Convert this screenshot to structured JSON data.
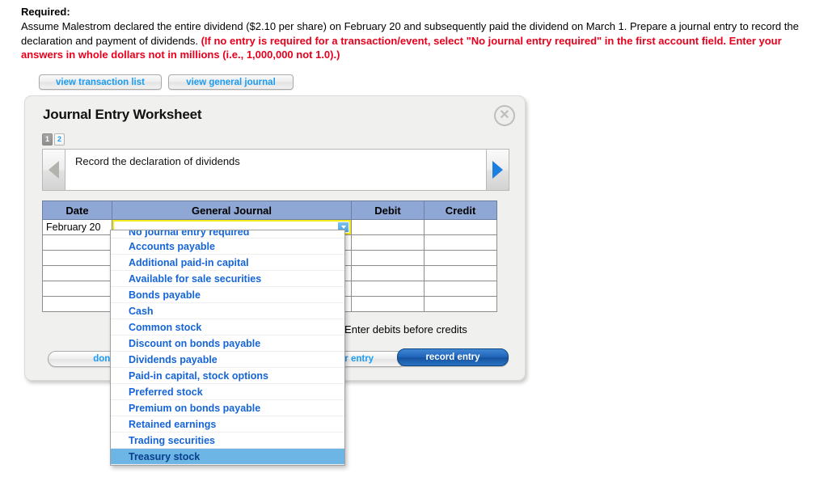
{
  "prompt": {
    "label": "Required:",
    "body_plain": "Assume Malestrom declared the entire dividend ($2.10 per share) on February 20 and subsequently paid the dividend on March 1. Prepare a journal entry to record the declaration and payment of dividends. ",
    "body_red": "(If no entry is required for a transaction/event, select \"No journal entry required\" in the first account field. Enter your answers in whole dollars not in millions (i.e., 1,000,000 not 1.0).)",
    "red_color": "#e8001c"
  },
  "view_buttons": {
    "transaction_list": "view transaction list",
    "general_journal": "view general journal"
  },
  "worksheet": {
    "title": "Journal Entry Worksheet",
    "close_icon": "close-icon",
    "close_glyph": "✕",
    "steps": [
      {
        "label": "1",
        "selected": true
      },
      {
        "label": "2",
        "selected": false
      }
    ],
    "instruction": "Record the declaration of dividends",
    "prev_arrow_icon": "triangle-left-icon",
    "next_arrow_icon": "triangle-right-icon",
    "table": {
      "headers": [
        "Date",
        "General Journal",
        "Debit",
        "Credit"
      ],
      "header_color": "#8fa7d4",
      "rows": [
        {
          "date": "February 20",
          "account": "",
          "debit": "",
          "credit": "",
          "account_open": true
        },
        {
          "date": "",
          "account": "",
          "debit": "",
          "credit": "",
          "account_open": false
        },
        {
          "date": "",
          "account": "",
          "debit": "",
          "credit": "",
          "account_open": false
        },
        {
          "date": "",
          "account": "",
          "debit": "",
          "credit": "",
          "account_open": false
        },
        {
          "date": "",
          "account": "",
          "debit": "",
          "credit": "",
          "account_open": false
        },
        {
          "date": "",
          "account": "",
          "debit": "",
          "credit": "",
          "account_open": false
        }
      ]
    },
    "debits_note": "*Enter debits before credits",
    "footer": {
      "done": "done",
      "clear_entry": "clear entry",
      "record_entry": "record entry"
    }
  },
  "dropdown": {
    "selected": "Treasury stock",
    "items": [
      "No journal entry required",
      "Accounts payable",
      "Additional paid-in capital",
      "Available for sale securities",
      "Bonds payable",
      "Cash",
      "Common stock",
      "Discount on bonds payable",
      "Dividends payable",
      "Paid-in capital, stock options",
      "Preferred stock",
      "Premium on bonds payable",
      "Retained earnings",
      "Trading securities",
      "Treasury stock"
    ],
    "highlight_color": "#6cb5e4",
    "item_color": "#1565d8"
  }
}
